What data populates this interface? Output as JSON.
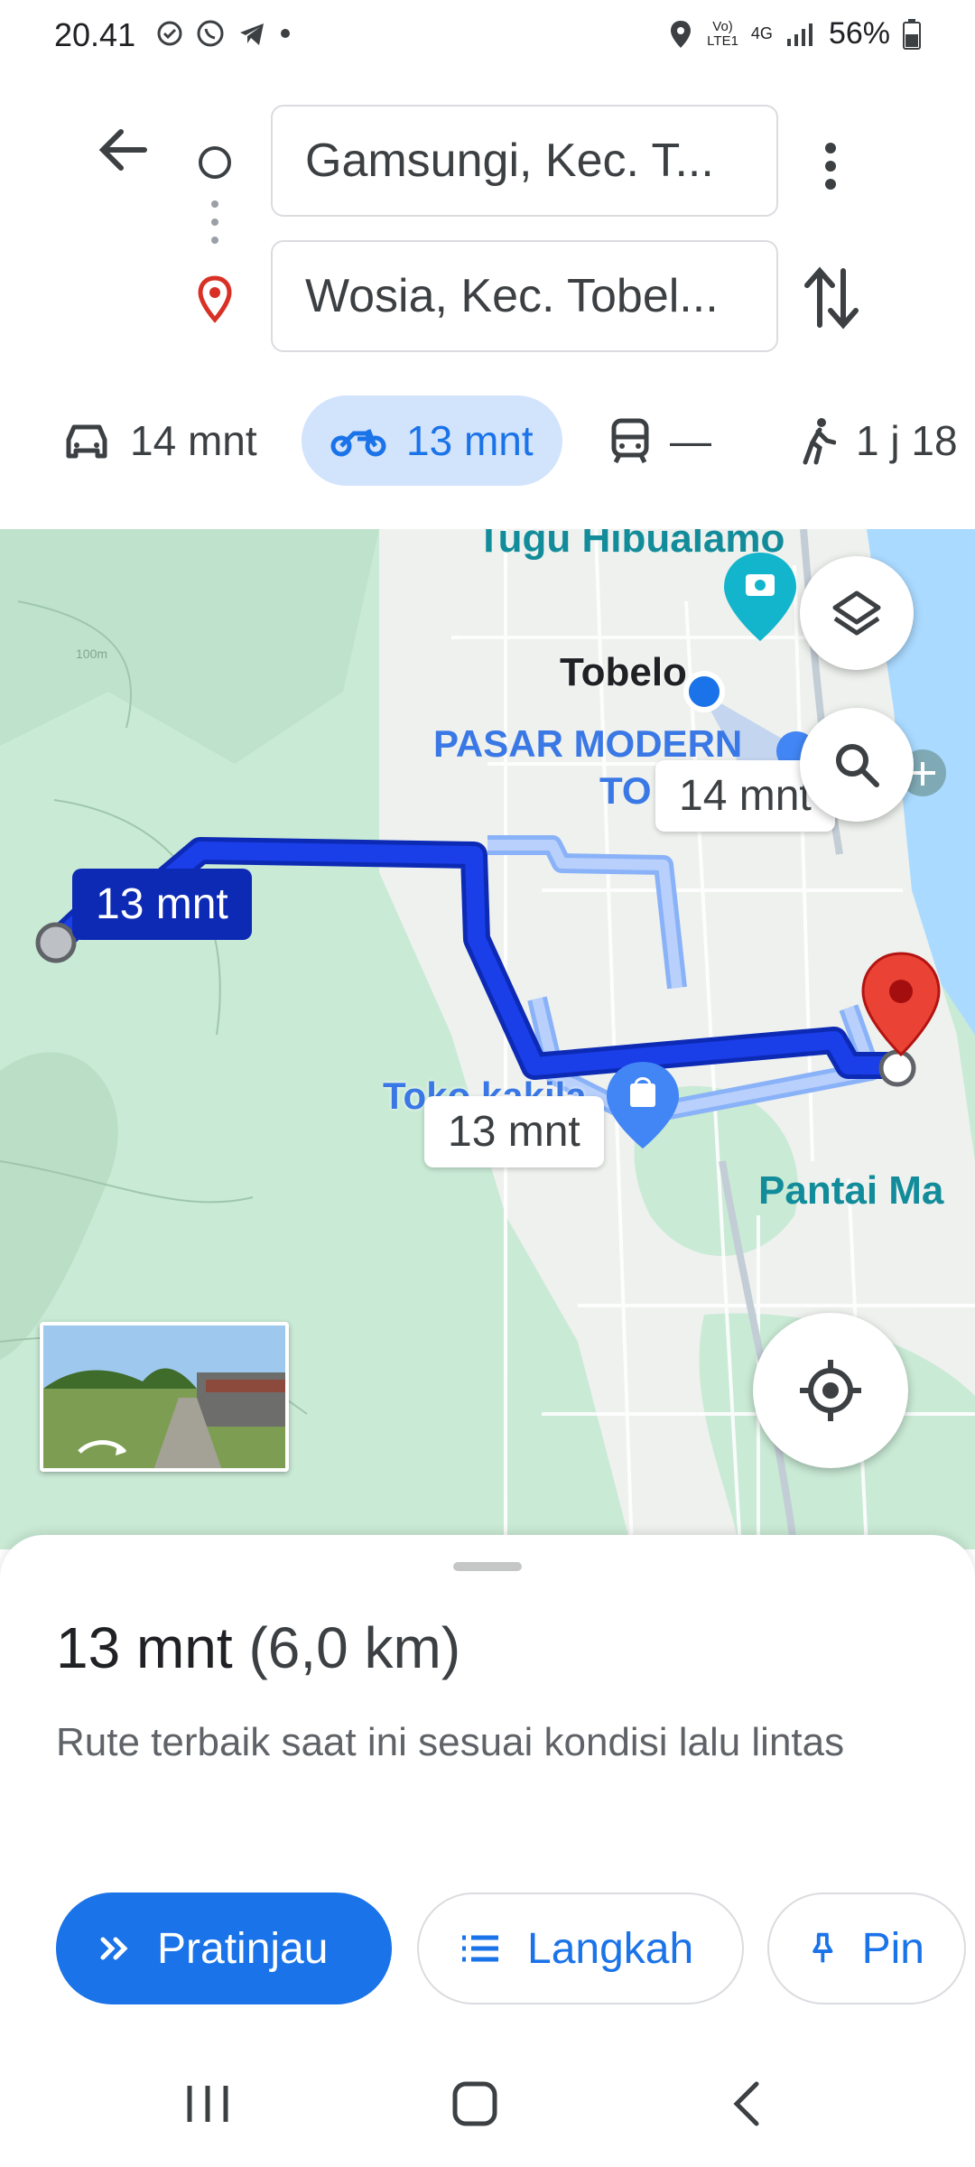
{
  "status_bar": {
    "time": "20.41",
    "network": "Vo)\nLTE1",
    "network_line1": "Vo)",
    "network_line2": "LTE1",
    "data_type": "4G",
    "battery": "56%"
  },
  "directions": {
    "origin": "Gamsungi, Kec. T...",
    "destination": "Wosia, Kec. Tobel..."
  },
  "travel_modes": [
    {
      "icon": "car-icon",
      "label": "14 mnt",
      "active": false
    },
    {
      "icon": "motorcycle-icon",
      "label": "13 mnt",
      "active": true
    },
    {
      "icon": "transit-icon",
      "label": "—",
      "active": false
    },
    {
      "icon": "walk-icon",
      "label": "1 j 18"
    }
  ],
  "map": {
    "places": {
      "tugu": "Tugu Hibualamo",
      "tobelo": "Tobelo",
      "pasar_line1": "PASAR MODERN",
      "pasar_line2": "TO",
      "toko": "Toko kakila",
      "pantai": "Pantai Ma"
    },
    "route_labels": {
      "primary": "13 mnt",
      "alt1": "14 mnt",
      "alt2": "13 mnt"
    },
    "contour": "100m",
    "colors": {
      "route": "#1a3ee8",
      "route_alt": "#a7c3fb",
      "land": "#c9ead5",
      "water": "#aadaff"
    }
  },
  "sheet": {
    "duration": "13 mnt",
    "distance": "(6,0 km)",
    "description": "Rute terbaik saat ini sesuai kondisi lalu lintas",
    "buttons": {
      "preview": "Pratinjau",
      "steps": "Langkah",
      "pin": "Pin"
    }
  }
}
